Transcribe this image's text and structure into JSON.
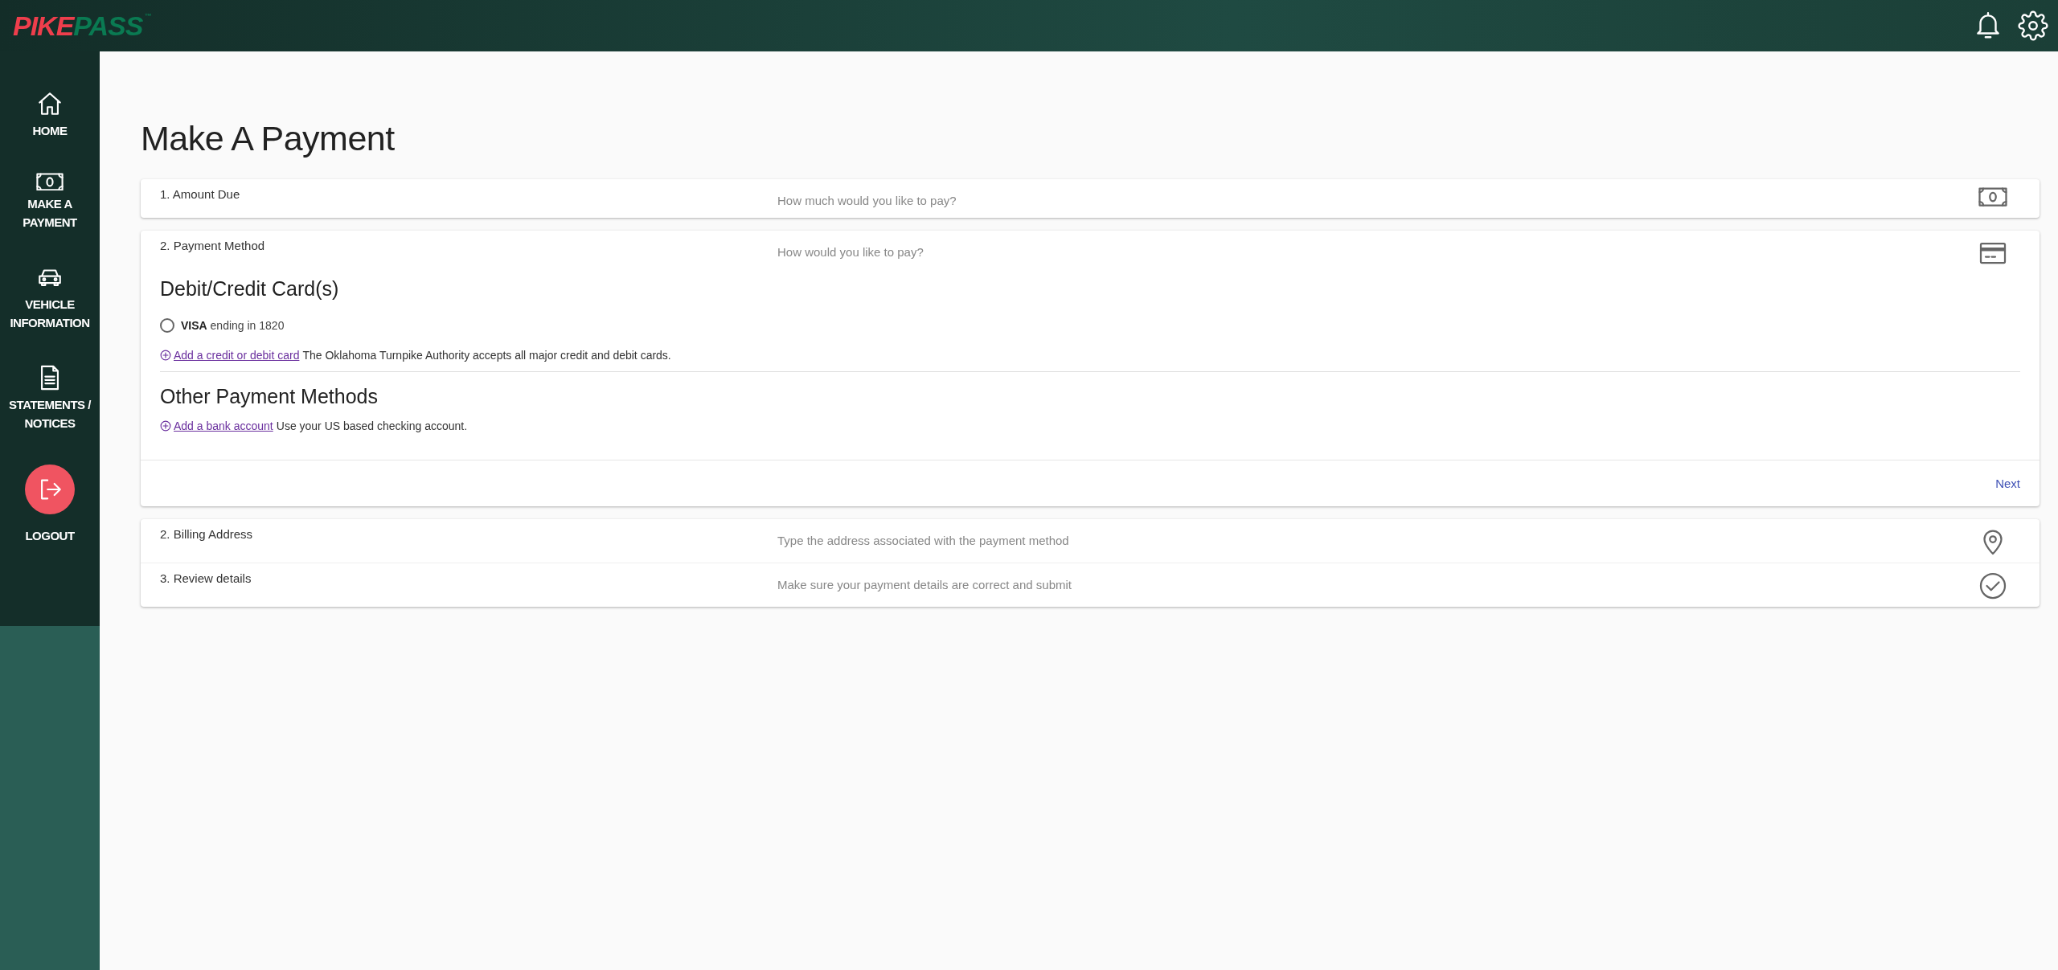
{
  "header": {
    "logo": {
      "part_1": "PIKE",
      "part_2": "PASS",
      "mark": "™"
    }
  },
  "sidebar": {
    "items": [
      {
        "label": "HOME",
        "kind": "home"
      },
      {
        "label": "MAKE A PAYMENT",
        "kind": "money"
      },
      {
        "label": "VEHICLE INFORMATION",
        "kind": "car"
      },
      {
        "label": "STATEMENTS / NOTICES",
        "kind": "document"
      },
      {
        "label": "LOGOUT",
        "kind": "logout"
      }
    ]
  },
  "page": {
    "title": "Make A Payment"
  },
  "amount_step": {
    "label": "1. Amount Due",
    "hint": "How much would you like to pay?",
    "kind": "money"
  },
  "payment_step": {
    "label": "2. Payment Method",
    "hint": "How would you like to pay?",
    "kind": "card",
    "cards_heading": "Debit/Credit Card(s)",
    "cards": [
      {
        "brand": "VISA",
        "text": "ending in 1820",
        "selected": false
      }
    ],
    "add_card": {
      "link": "Add a credit or debit card",
      "note": "The Oklahoma Turnpike Authority accepts all major credit and debit cards."
    },
    "other_heading": "Other Payment Methods",
    "add_bank": {
      "link": "Add a bank account",
      "note": "Use your US based checking account."
    },
    "next_button": "Next"
  },
  "later_steps": [
    {
      "label": "2. Billing Address",
      "hint": "Type the address associated with the payment method",
      "kind": "pin"
    },
    {
      "label": "3. Review details",
      "hint": "Make sure your payment details are correct and submit",
      "kind": "check"
    }
  ]
}
